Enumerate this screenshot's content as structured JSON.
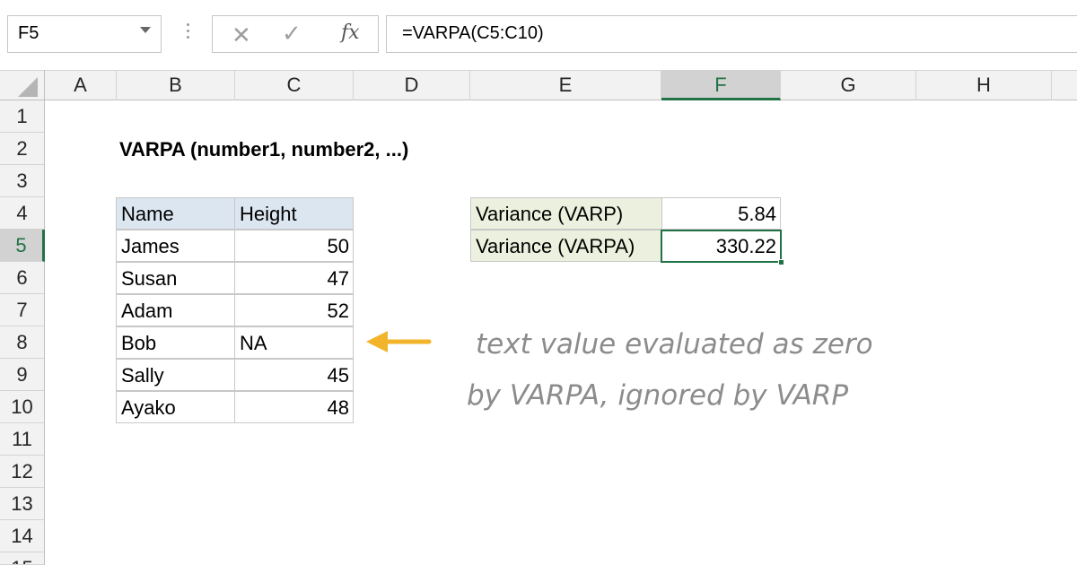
{
  "formula_bar": {
    "name_box": "F5",
    "cancel_icon": "close-icon",
    "enter_icon": "checkmark-icon",
    "fx_label": "fx",
    "formula": "=VARPA(C5:C10)"
  },
  "columns": [
    "A",
    "B",
    "C",
    "D",
    "E",
    "F",
    "G",
    "H"
  ],
  "selected_column": "F",
  "rows": [
    "1",
    "2",
    "3",
    "4",
    "5",
    "6",
    "7",
    "8",
    "9",
    "10",
    "11",
    "12",
    "13",
    "14",
    "15"
  ],
  "selected_row": "5",
  "sheet": {
    "title": "VARPA (number1, number2, ...)",
    "table_headers": [
      "Name",
      "Height"
    ],
    "table_rows": [
      {
        "name": "James",
        "height": "50"
      },
      {
        "name": "Susan",
        "height": "47"
      },
      {
        "name": "Adam",
        "height": "52"
      },
      {
        "name": "Bob",
        "height": "NA"
      },
      {
        "name": "Sally",
        "height": "45"
      },
      {
        "name": "Ayako",
        "height": "48"
      }
    ],
    "results": [
      {
        "label": "Variance (VARP)",
        "value": "5.84"
      },
      {
        "label": "Variance (VARPA)",
        "value": "330.22"
      }
    ],
    "note_line1": "text value evaluated as zero",
    "note_line2": "by VARPA, ignored by VARP"
  },
  "colors": {
    "accent": "#217346",
    "table_header_fill": "#dce6f1",
    "label_fill": "#ebf1de",
    "arrow": "#f2b42b",
    "note_text": "#8c8c8c"
  }
}
